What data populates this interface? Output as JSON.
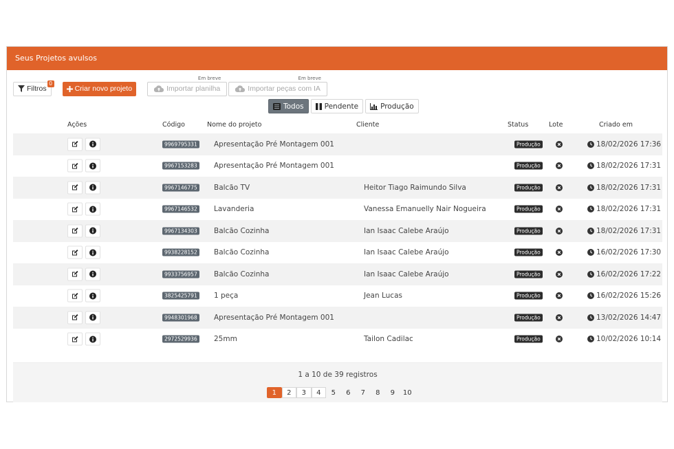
{
  "panel": {
    "title": "Seus Projetos avulsos"
  },
  "toolbar": {
    "filter_label": "Filtros",
    "filter_count": "0",
    "create_label": "Criar novo projeto",
    "import_sheet_label": "Importar planilha",
    "import_sheet_tag": "Em breve",
    "import_ai_label": "Importar peças com IA",
    "import_ai_tag": "Em breve"
  },
  "tabs": [
    {
      "label": "Todos",
      "icon": "list-icon",
      "active": true
    },
    {
      "label": "Pendente",
      "icon": "pause-icon",
      "active": false
    },
    {
      "label": "Produção",
      "icon": "bar-chart-icon",
      "active": false
    }
  ],
  "table": {
    "headers": {
      "actions": "Ações",
      "code": "Código",
      "name": "Nome do projeto",
      "client": "Cliente",
      "status": "Status",
      "batch": "Lote",
      "created": "Criado em"
    },
    "rows": [
      {
        "code": "9969795331",
        "name": "Apresentação Pré Montagem 001",
        "client": "",
        "status": "Produção",
        "created": "18/02/2026 17:36"
      },
      {
        "code": "9967153283",
        "name": "Apresentação Pré Montagem 001",
        "client": "",
        "status": "Produção",
        "created": "18/02/2026 17:31"
      },
      {
        "code": "9967146775",
        "name": "Balcão TV",
        "client": "Heitor Tiago Raimundo Silva",
        "status": "Produção",
        "created": "18/02/2026 17:31"
      },
      {
        "code": "9967146532",
        "name": "Lavanderia",
        "client": "Vanessa Emanuelly Nair Nogueira",
        "status": "Produção",
        "created": "18/02/2026 17:31"
      },
      {
        "code": "9967134303",
        "name": "Balcão Cozinha",
        "client": "Ian Isaac Calebe Araújo",
        "status": "Produção",
        "created": "18/02/2026 17:31"
      },
      {
        "code": "9938228152",
        "name": "Balcão Cozinha",
        "client": "Ian Isaac Calebe Araújo",
        "status": "Produção",
        "created": "16/02/2026 17:30"
      },
      {
        "code": "9933756957",
        "name": "Balcão Cozinha",
        "client": "Ian Isaac Calebe Araújo",
        "status": "Produção",
        "created": "16/02/2026 17:22"
      },
      {
        "code": "3825425791",
        "name": "1 peça",
        "client": "Jean Lucas",
        "status": "Produção",
        "created": "16/02/2026 15:26"
      },
      {
        "code": "9948301968",
        "name": "Apresentação Pré Montagem 001",
        "client": "",
        "status": "Produção",
        "created": "13/02/2026 14:47"
      },
      {
        "code": "2972529936",
        "name": "25mm",
        "client": "Tailon Cadilac",
        "status": "Produção",
        "created": "10/02/2026 10:14"
      }
    ]
  },
  "pagination": {
    "info": "1 a 10 de 39 registros",
    "pages": [
      "1",
      "2",
      "3",
      "4",
      "5",
      "6",
      "7",
      "8",
      "9",
      "10"
    ],
    "active_page": "1"
  },
  "colors": {
    "accent": "#e0632a",
    "tab_active": "#6c757d",
    "badge_dark": "#2c2c2c",
    "code_badge": "#5d6770"
  }
}
